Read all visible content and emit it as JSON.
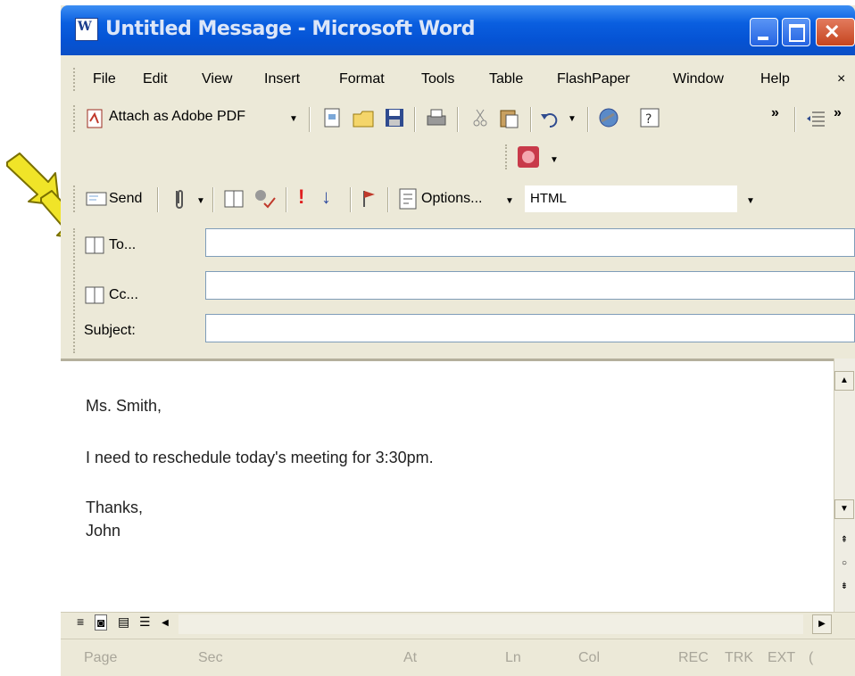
{
  "window": {
    "title": "Untitled Message - Microsoft Word"
  },
  "menu": {
    "items": [
      "File",
      "Edit",
      "View",
      "Insert",
      "Format",
      "Tools",
      "Table",
      "FlashPaper",
      "Window",
      "Help"
    ],
    "close_doc": "×"
  },
  "toolbar1": {
    "attach_pdf": "Attach as Adobe PDF"
  },
  "toolbar2": {
    "send": "Send",
    "options": "Options...",
    "format": "HTML"
  },
  "fields": {
    "to_label": "To...",
    "cc_label": "Cc...",
    "subject_label": "Subject:",
    "to_value": "",
    "cc_value": "",
    "subject_value": ""
  },
  "body": {
    "line1": "Ms. Smith,",
    "line2": "I need to reschedule today's meeting for 3:30pm.",
    "line3": "Thanks,",
    "line4": "John"
  },
  "status": {
    "page": "Page",
    "sec": "Sec",
    "at": "At",
    "ln": "Ln",
    "col": "Col",
    "rec": "REC",
    "trk": "TRK",
    "ext": "EXT",
    "ovr": "("
  },
  "colors": {
    "titlebar": "#0553D4",
    "chrome": "#ECE9D8",
    "annotation_arrow": "#F0E428"
  }
}
